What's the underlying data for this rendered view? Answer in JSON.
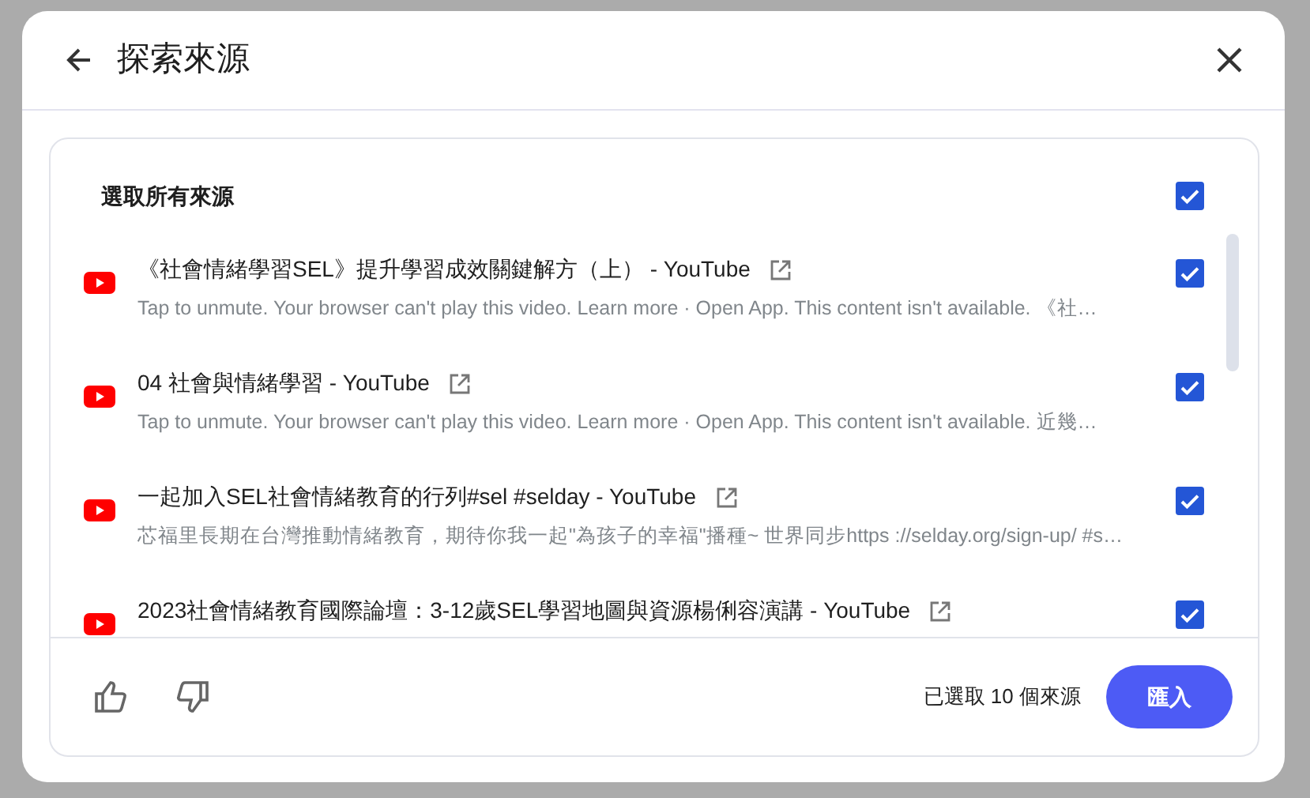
{
  "dialog": {
    "title": "探索來源",
    "select_all": {
      "label": "選取所有來源",
      "checked": true
    },
    "sources": [
      {
        "title": "《社會情緒學習SEL》提升學習成效關鍵解方（上） - YouTube",
        "description": "Tap to unmute. Your browser can't play this video. Learn more · Open App. This content isn't available. 《社…",
        "checked": true
      },
      {
        "title": "04 社會與情緒學習 - YouTube",
        "description": "Tap to unmute. Your browser can't play this video. Learn more · Open App. This content isn't available. 近幾…",
        "checked": true
      },
      {
        "title": "一起加入SEL社會情緒教育的行列#sel #selday - YouTube",
        "description": "芯福里長期在台灣推動情緒教育，期待你我一起\"為孩子的幸福\"播種~ 世界同步https ://selday.org/sign-up/ #s…",
        "checked": true
      },
      {
        "title": "2023社會情緒教育國際論壇：3-12歲SEL學習地圖與資源楊俐容演講 - YouTube",
        "checked": true
      }
    ],
    "footer": {
      "count_text": "已選取 10 個來源",
      "import_button": "匯入"
    }
  }
}
